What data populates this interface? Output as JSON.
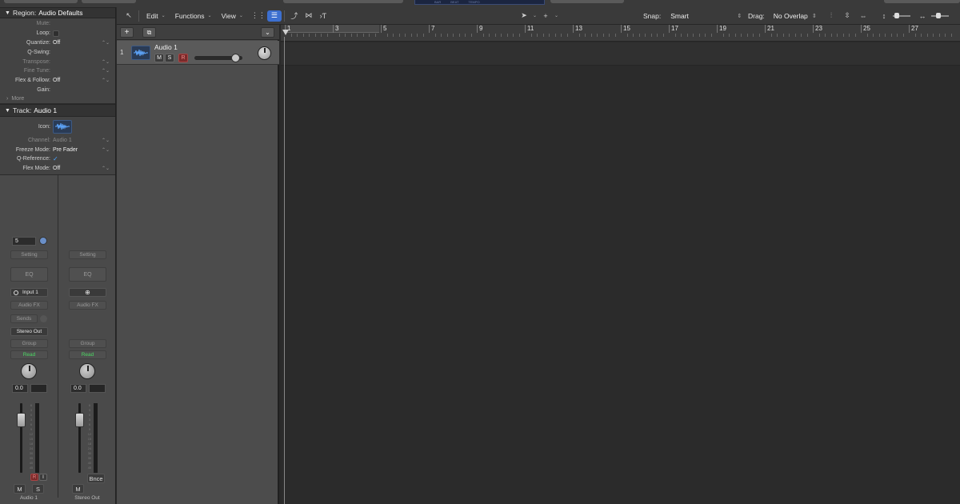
{
  "inspector": {
    "region_header": {
      "label": "Region:",
      "value": "Audio Defaults"
    },
    "region_props": [
      {
        "label": "Mute:",
        "value": "",
        "kind": "dim"
      },
      {
        "label": "Loop:",
        "value": "",
        "kind": "checkbox"
      },
      {
        "label": "Quantize:",
        "value": "Off",
        "kind": "stepper"
      },
      {
        "label": "Q-Swing:",
        "value": "",
        "kind": "plain"
      },
      {
        "label": "Transpose:",
        "value": "",
        "kind": "dim-stepper"
      },
      {
        "label": "Fine Tune:",
        "value": "",
        "kind": "dim-stepper"
      },
      {
        "label": "Flex & Follow:",
        "value": "Off",
        "kind": "stepper"
      },
      {
        "label": "Gain:",
        "value": "",
        "kind": "plain"
      }
    ],
    "more_label": "More",
    "track_header": {
      "label": "Track:",
      "value": "Audio 1"
    },
    "track_props": {
      "icon_label": "Icon:",
      "channel_label": "Channel:",
      "channel_value": "Audio 1",
      "freeze_label": "Freeze Mode:",
      "freeze_value": "Pre Fader",
      "qref_label": "Q-Reference:",
      "qref_check": "✓",
      "flex_label": "Flex Mode:",
      "flex_value": "Off"
    }
  },
  "strips": [
    {
      "top_value": "5",
      "setting": "Setting",
      "eq": "EQ",
      "input": "Input 1",
      "audio_fx": "Audio FX",
      "sends": "Sends",
      "output": "Stereo Out",
      "group": "Group",
      "automation": "Read",
      "gain": "0.0",
      "scale": [
        "6",
        "3",
        "0",
        "3",
        "6",
        "9",
        "12",
        "15",
        "18",
        "24",
        "30",
        "35",
        "40",
        "45",
        "50",
        "60"
      ],
      "btn_m": "M",
      "btn_s": "S",
      "btn_r": "R",
      "btn_i": "I",
      "name": "Audio 1"
    },
    {
      "setting": "Setting",
      "eq": "EQ",
      "audio_fx": "Audio FX",
      "group": "Group",
      "automation": "Read",
      "gain": "0.0",
      "scale": [
        "6",
        "3",
        "0",
        "3",
        "6",
        "9",
        "12",
        "15",
        "18",
        "24",
        "30",
        "35",
        "40",
        "45",
        "50",
        "60"
      ],
      "btn_m": "M",
      "bounce": "Bnce",
      "name": "Stereo Out"
    }
  ],
  "toolbar": {
    "menus": [
      "Edit",
      "Functions",
      "View"
    ],
    "snap_label": "Snap:",
    "snap_value": "Smart",
    "drag_label": "Drag:",
    "drag_value": "No Overlap"
  },
  "lcd": {
    "labels": [
      "BAR",
      "BEAT",
      "TEMPO"
    ]
  },
  "tracks": [
    {
      "number": "1",
      "name": "Audio 1",
      "mute": "M",
      "solo": "S",
      "record": "R",
      "volume_fraction": 0.87
    }
  ],
  "ruler": {
    "bars": [
      "1",
      "3",
      "5",
      "7",
      "9",
      "11",
      "13",
      "15",
      "17",
      "19",
      "21",
      "23",
      "25",
      "27"
    ]
  },
  "colors": {
    "accent": "#3c6fcf",
    "automation_read": "#4cd964",
    "record": "#7a2a2a"
  },
  "icons": [
    "back-arrow-icon",
    "grid-view-icon",
    "list-view-icon",
    "catch-icon",
    "flex-icon",
    "pointer-tool-icon",
    "marquee-tool-icon",
    "waveform-zoom-icon",
    "vertical-zoom-icon",
    "horizontal-zoom-icon",
    "add-track-icon",
    "duplicate-track-icon",
    "collapse-icon",
    "audio-waveform-icon",
    "link-icon"
  ]
}
